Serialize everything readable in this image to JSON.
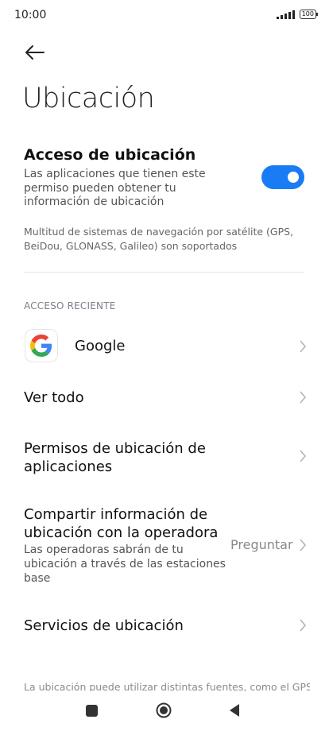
{
  "status_bar": {
    "time": "10:00",
    "battery": "100"
  },
  "page": {
    "title": "Ubicación"
  },
  "location_access": {
    "title": "Acceso de ubicación",
    "description": "Las aplicaciones que tienen este permiso pueden obtener tu información de ubicación",
    "enabled": true,
    "accent_color": "#1a7cf5"
  },
  "gnss_note": "Multitud de sistemas de navegación por satélite (GPS, BeiDou, GLONASS, Galileo) son soportados",
  "recent_access": {
    "header": "ACCESO RECIENTE",
    "apps": [
      {
        "name": "Google",
        "icon": "google-icon"
      }
    ]
  },
  "rows": {
    "see_all": "Ver todo",
    "app_permissions": "Permisos de ubicación de aplicaciones",
    "carrier_sharing": {
      "title": "Compartir información de ubicación con la operadora",
      "description": "Las operadoras sabrán de tu ubicación a través de las estaciones base",
      "value": "Preguntar"
    },
    "location_services": "Servicios de ubicación"
  },
  "footer": "La ubicación puede utilizar distintas fuentes, como el GPS,"
}
